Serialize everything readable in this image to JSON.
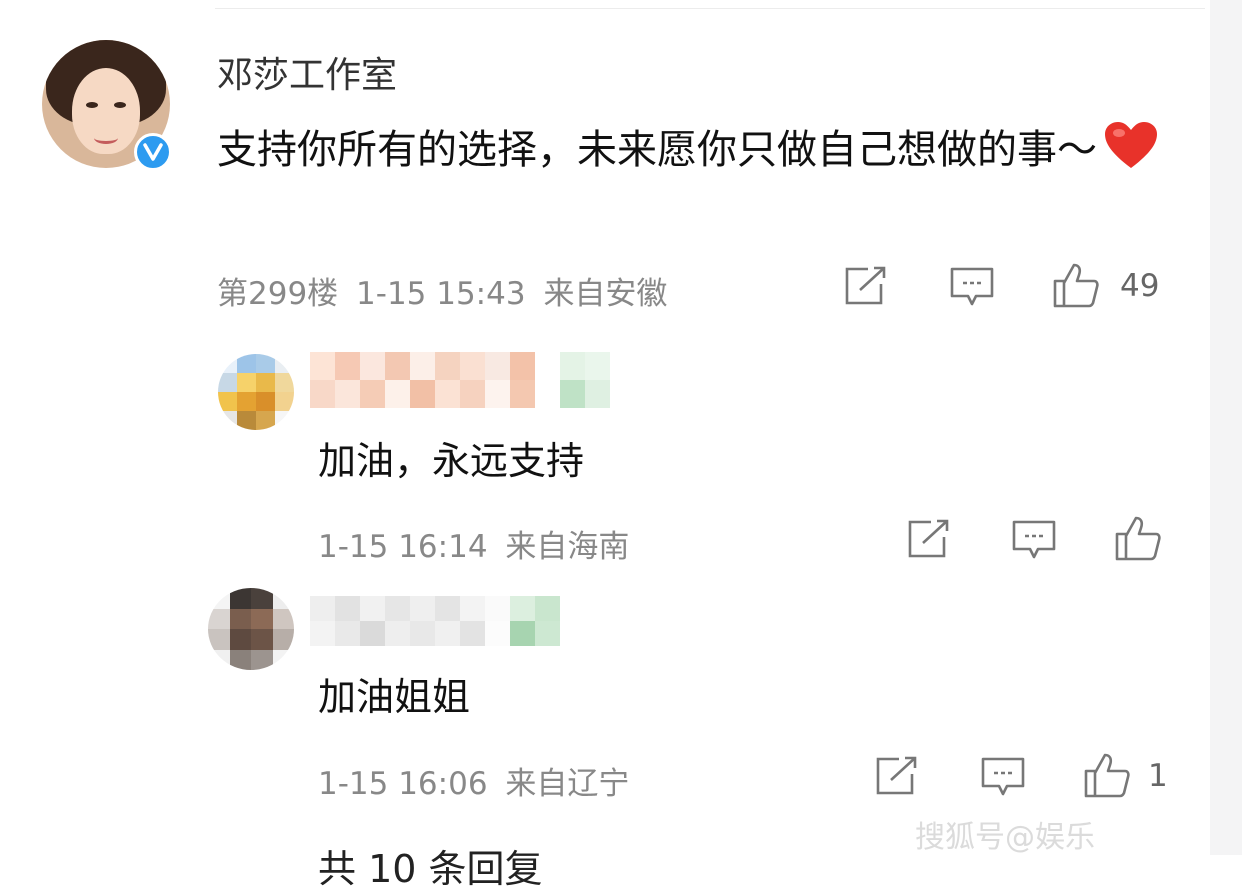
{
  "comment": {
    "author": "邓莎工作室",
    "text": "支持你所有的选择，未来愿你只做自己想做的事～",
    "floor": "第299楼",
    "time": "1-15 15:43",
    "location": "来自安徽",
    "likes": "49"
  },
  "replies": [
    {
      "text": "加油，永远支持",
      "time": "1-15 16:14",
      "location": "来自海南",
      "likes": ""
    },
    {
      "text": "加油姐姐",
      "time": "1-15 16:06",
      "location": "来自辽宁",
      "likes": "1"
    }
  ],
  "footer": {
    "partial_text": "共 10 条回复"
  },
  "watermark": "搜狐号@娱乐"
}
